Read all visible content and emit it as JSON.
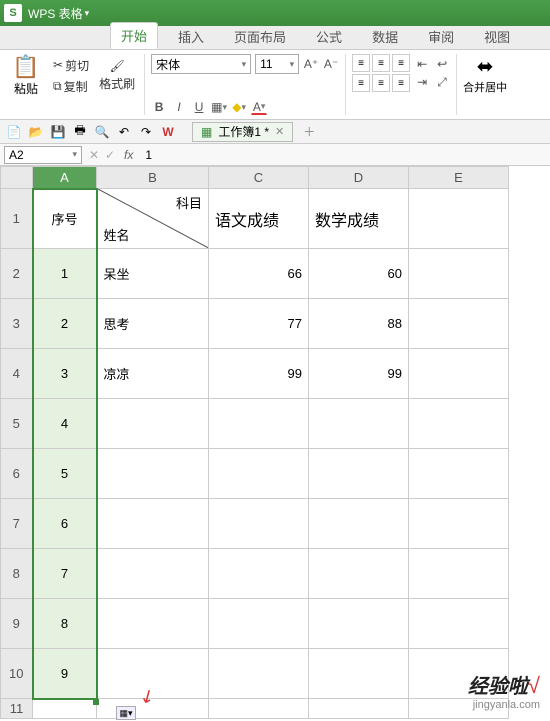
{
  "app": {
    "name": "WPS 表格",
    "logo": "S"
  },
  "menu_dropdown": "WPS 表格",
  "tabs": [
    "开始",
    "插入",
    "页面布局",
    "公式",
    "数据",
    "审阅",
    "视图"
  ],
  "active_tab": 0,
  "clipboard": {
    "paste": "粘贴",
    "cut": "剪切",
    "copy": "复制",
    "format_painter": "格式刷"
  },
  "font": {
    "name": "宋体",
    "size": "11"
  },
  "merge_label": "合并居中",
  "doc_tab": {
    "label": "工作簿1 *"
  },
  "qat_wps": "W",
  "namebox": "A2",
  "formula_value": "1",
  "columns": [
    "A",
    "B",
    "C",
    "D",
    "E"
  ],
  "headers": {
    "seq": "序号",
    "subject": "科目",
    "name": "姓名",
    "chinese": "语文成绩",
    "math": "数学成绩"
  },
  "rows": [
    {
      "n": "1",
      "seq": "1",
      "name": "呆坐",
      "c": "66",
      "m": "60"
    },
    {
      "n": "2",
      "seq": "2",
      "name": "思考",
      "c": "77",
      "m": "88"
    },
    {
      "n": "3",
      "seq": "3",
      "name": "凉凉",
      "c": "99",
      "m": "99"
    },
    {
      "n": "4",
      "seq": "4",
      "name": "",
      "c": "",
      "m": ""
    },
    {
      "n": "5",
      "seq": "5",
      "name": "",
      "c": "",
      "m": ""
    },
    {
      "n": "6",
      "seq": "6",
      "name": "",
      "c": "",
      "m": ""
    },
    {
      "n": "7",
      "seq": "7",
      "name": "",
      "c": "",
      "m": ""
    },
    {
      "n": "8",
      "seq": "8",
      "name": "",
      "c": "",
      "m": ""
    },
    {
      "n": "9",
      "seq": "9",
      "name": "",
      "c": "",
      "m": ""
    }
  ],
  "row11": "11",
  "watermark": {
    "brand": "经验啦",
    "check": "√",
    "url": "jingyanla.com"
  }
}
